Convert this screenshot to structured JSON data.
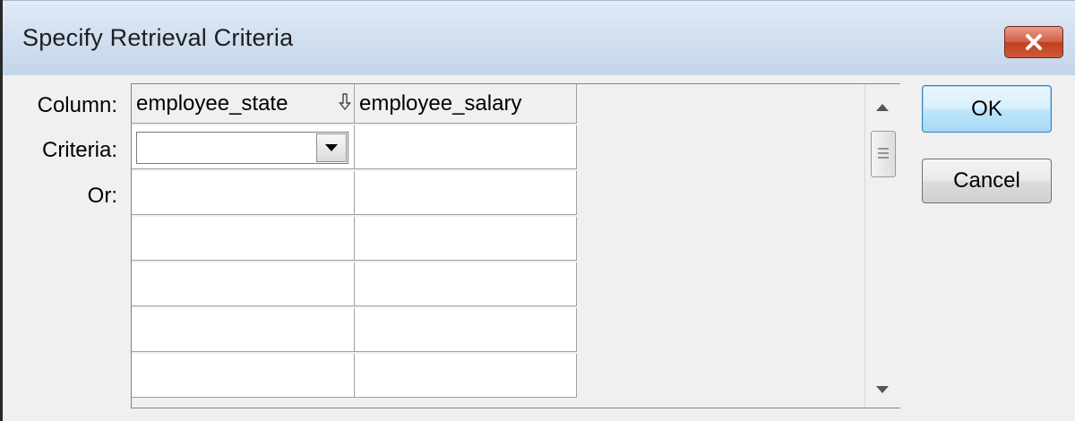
{
  "window": {
    "title": "Specify Retrieval Criteria",
    "close_icon": "close-x-icon"
  },
  "row_labels": {
    "column": "Column:",
    "criteria": "Criteria:",
    "or": "Or:"
  },
  "grid": {
    "columns": [
      "employee_state",
      "employee_salary"
    ],
    "criteria_values": [
      "",
      ""
    ],
    "or_rows": [
      [
        "",
        ""
      ],
      [
        "",
        ""
      ],
      [
        "",
        ""
      ],
      [
        "",
        ""
      ],
      [
        "",
        ""
      ]
    ],
    "sort_icon": "sort-down-arrow-icon",
    "dropdown_icon": "dropdown-triangle-icon"
  },
  "buttons": {
    "ok": "OK",
    "cancel": "Cancel"
  },
  "colors": {
    "title_bar": "#c4d5ea",
    "close_button": "#c0401f",
    "default_button": "#bee6fd",
    "dialog_bg": "#f0f0f0"
  }
}
